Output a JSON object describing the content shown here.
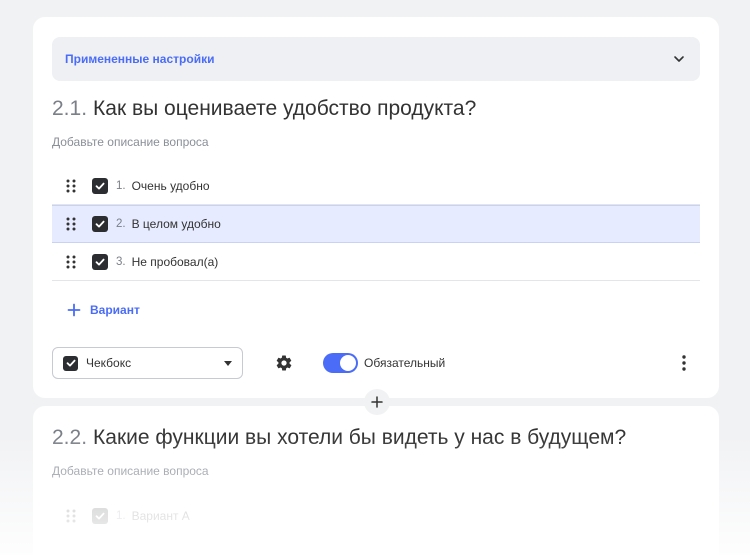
{
  "settings": {
    "label": "Примененные настройки",
    "icon": "chevron-down-icon"
  },
  "question1": {
    "number": "2.1.",
    "title": "Как вы оцениваете удобство продукта?",
    "description_placeholder": "Добавьте описание вопроса",
    "options": [
      {
        "index": "1.",
        "label": "Очень удобно",
        "checked": true
      },
      {
        "index": "2.",
        "label": "В целом удобно",
        "checked": true,
        "highlighted": true
      },
      {
        "index": "3.",
        "label": "Не пробовал(а)",
        "checked": true
      }
    ],
    "add_variant_label": "Вариант",
    "type_select": {
      "value": "Чекбокс"
    },
    "required_toggle": {
      "label": "Обязательный",
      "on": true
    }
  },
  "question2": {
    "number": "2.2.",
    "title": "Какие функции вы хотели бы видеть у нас в будущем?",
    "description_placeholder": "Добавьте описание вопроса",
    "options": [
      {
        "index": "1.",
        "label": "Вариант А",
        "checked": true
      }
    ]
  },
  "colors": {
    "accent": "#4a6cf7",
    "highlight_row": "#e6ebff",
    "checkbox": "#2b2d31"
  }
}
